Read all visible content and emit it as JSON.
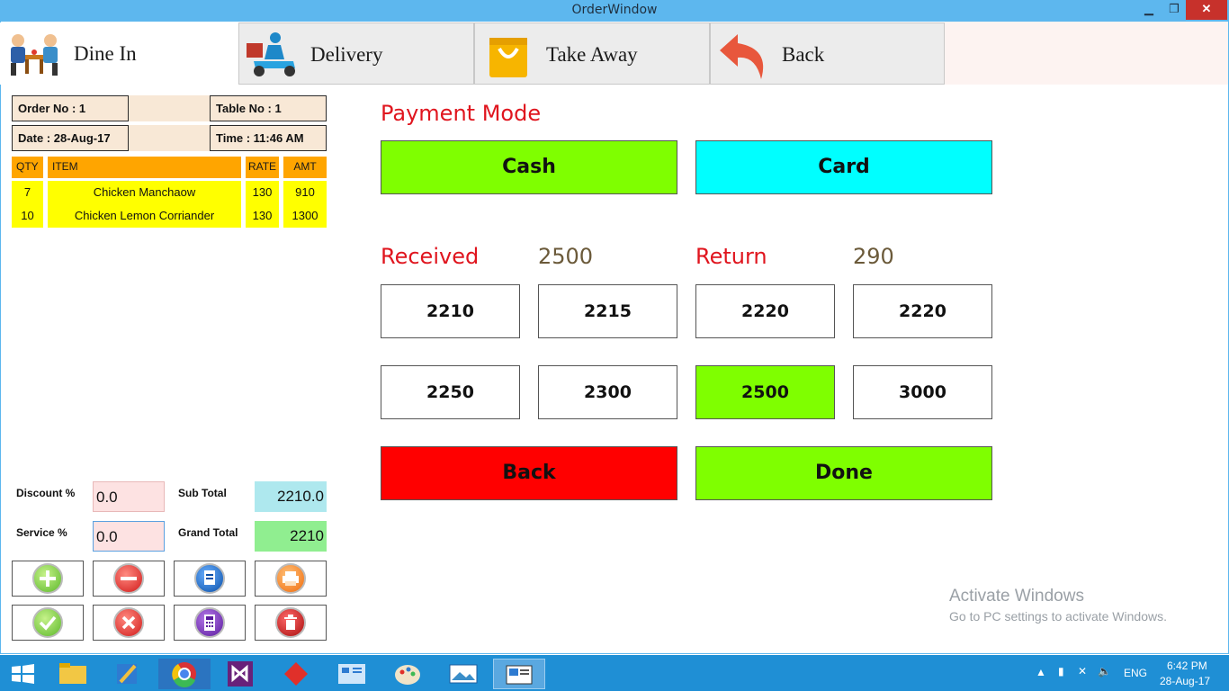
{
  "window": {
    "title": "OrderWindow",
    "min": "▁",
    "max": "❐",
    "close": "✕"
  },
  "tabs": [
    {
      "label": "Dine In",
      "icon": "dining-people-icon"
    },
    {
      "label": "Delivery",
      "icon": "delivery-scooter-icon"
    },
    {
      "label": "Take Away",
      "icon": "shopping-bag-icon"
    },
    {
      "label": "Back",
      "icon": "back-arrow-icon"
    }
  ],
  "order": {
    "order_no": "Order No :   1",
    "table_no": "Table No :    1",
    "date": "Date :   28-Aug-17",
    "time": "Time :      11:46 AM"
  },
  "table": {
    "headers": [
      "QTY",
      "ITEM",
      "RATE",
      "AMT"
    ],
    "rows": [
      [
        "7",
        "Chicken Manchaow",
        "130",
        "910"
      ],
      [
        "10",
        "Chicken Lemon Corriander",
        "130",
        "1300"
      ]
    ]
  },
  "totals": {
    "discount_label": "Discount %",
    "discount_value": "0.0",
    "service_label": "Service %",
    "service_value": "0.0",
    "subtotal_label": "Sub Total",
    "subtotal_value": "2210.0",
    "grandtotal_label": "Grand Total",
    "grandtotal_value": "2210"
  },
  "actions": [
    "add-icon",
    "remove-icon",
    "document-icon",
    "print-icon",
    "check-icon",
    "cancel-icon",
    "calculator-icon",
    "delete-icon"
  ],
  "payment": {
    "title": "Payment Mode",
    "cash": "Cash",
    "card": "Card",
    "received_label": "Received",
    "received_value": "2500",
    "return_label": "Return",
    "return_value": "290",
    "amounts": [
      "2210",
      "2215",
      "2220",
      "2220",
      "2250",
      "2300",
      "2500",
      "3000"
    ],
    "back": "Back",
    "done": "Done"
  },
  "watermark": {
    "line1": "Activate Windows",
    "line2": "Go to PC settings to activate Windows."
  },
  "taskbar": {
    "lang": "ENG",
    "time": "6:42 PM",
    "date": "28-Aug-17"
  },
  "colors": {
    "green": "#7fff00",
    "cyan": "#00ffff",
    "red": "#ff0000",
    "yellow": "#ffff00",
    "orange": "#ffa500"
  }
}
